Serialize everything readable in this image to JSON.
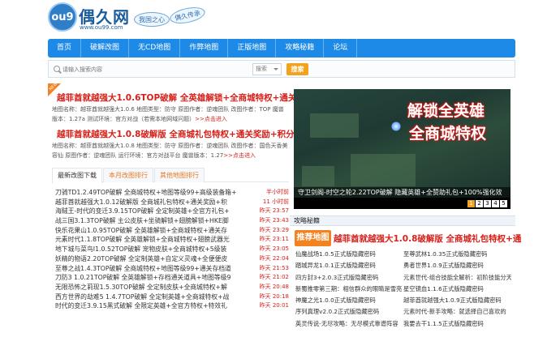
{
  "brand": {
    "logo_mark": "ou9",
    "name": "偶久网",
    "url": "www.ou99.com",
    "slogan_1": "我国之心",
    "slogan_2": "偶久传承"
  },
  "nav": {
    "items": [
      "首页",
      "破解改图",
      "无CD地图",
      "作弊地图",
      "正版地图",
      "攻略秘籍",
      "论坛"
    ]
  },
  "search": {
    "placeholder": "请输入搜索内容",
    "category": "搜索",
    "button": "搜索"
  },
  "headlines": {
    "badge": "NEW",
    "items": [
      {
        "title": "越菲酋就越强大1.0.6TOP破解 全英雄解锁+全商城特权+通关存档",
        "desc": "地图名称：越菲酋就越强大1.0.6 地图类型：防守 原图作者：逆魂团队 改图作者：TOP 魔兽版本：1.27a 测试环境：官方对战（若需本地网域问题）",
        "more": ">>点击进入"
      },
      {
        "title": "越菲酋就越强大1.0.8破解版 全商城礼包特权+通关奖励+积分道具",
        "desc": "地图名称：越菲酋就越强大1.0.8 地图类型：防守 原图作者：逆魂团队 改图作者：国色天香美容仙 原图作者：逆魂团队 运行环境：官方对战平台 魔兽版本：1.27",
        "more": ">>点击进入"
      }
    ]
  },
  "tabs": [
    "最新改图下载",
    "本月改图排行",
    "其他地图排行"
  ],
  "downloads": [
    {
      "title": "刀骑TD1.2.49TOP破解 全商城特权+地图等级99+高级装备箱+",
      "date": "半小时前"
    },
    {
      "title": "越菲酋就越强大1.0.12破解版 全商城礼包特权+通关奖励+积",
      "date": "11 小时前"
    },
    {
      "title": "海贼王-时代的变迁3.9.15TOP破解 全定制英雄+全官方礼包+",
      "date": "昨天 23:57"
    },
    {
      "title": "战三国3.1.3TOP破解 主公皮肤+坐骑解锁+翅膀解锁+HKE脚",
      "date": "昨天 23:43"
    },
    {
      "title": "快乐花果山1.0.95TOP破解 全英雄解锁+全商城特权+通关存",
      "date": "昨天 23:29"
    },
    {
      "title": "元素时代1.1.8TOP破解 全英雄解锁+全商城特权+翅膀武器光",
      "date": "昨天 23:11"
    },
    {
      "title": "地下城与菜鸟Ⅰ1.0.52TOP破解 宠物皮肤+全商城特权+5级装",
      "date": "昨天 23:05"
    },
    {
      "title": "妖精的物语2.20TOP破解 全定制英雄+自定义灵魂+全便便皮",
      "date": "昨天 22:04"
    },
    {
      "title": "至尊之战1.4.3TOP破解 全商城特权+地图等级99+通关存档道",
      "date": "昨天 21:53"
    },
    {
      "title": "刀防3 1.0.21TOP破解 全英雄解锁+存档通关道具+地图等级9",
      "date": "昨天 21:02"
    },
    {
      "title": "无限恐怖之莉现1.5.30TOP破解 全定制皮肤+全商城特权+解",
      "date": "昨天 20:48"
    },
    {
      "title": "西方世界的劫难5 1.4.7TOP破解 全定制英雄+全商城特权+战",
      "date": "昨天 20:18"
    },
    {
      "title": "时代的变迁3.9.15黑式破解 全限定英雄+全官方特权+特效礼",
      "date": "昨天 20:01"
    }
  ],
  "banner": {
    "line1": "解锁全英雄",
    "line2": "全商城特权",
    "caption": "守卫剑阁-时空之轮2.22TOP破解 隐藏英雄+全赞助礼包+100%强化效",
    "pages": [
      "1",
      "2",
      "3",
      "4",
      "5"
    ],
    "active_page": 0
  },
  "strategy": {
    "header": "攻略秘籍",
    "badge": "推荐地图",
    "headline": "越菲酋就越强大1.0.8破解版 全商城礼包特权+通",
    "rows": [
      [
        "仙魔战场1.0.5正式版隐藏密码",
        "至尊武林1.0.35正式版隐藏密码"
      ],
      [
        "踏城异龙1.0.1正式版隐藏密码",
        "勇者世界1.0.9正式版隐藏密码"
      ],
      [
        "四方封3+2.0.3正式版隐藏密码",
        "元素世代-组合技能全解析：初阶技能分天"
      ],
      [
        "新蜀推零第三期：相信群众的眼睛是雪亮",
        "星空镜血1.1.6正式版隐藏密码"
      ],
      [
        "神魔之光1.0.0正式版隐藏密码",
        "越菲酋就越强大1.0.9正式版隐藏密码"
      ],
      [
        "序列真理v2.0.2正式版隐藏密码",
        "元素时代-新手攻略：就选择自己喜欢的"
      ],
      [
        "英灵传说-无尽攻略：无尽模式靠谱阵容",
        "我要去干1.1.5正式版隐藏密码"
      ]
    ]
  },
  "colors": {
    "nav_blue": "#1d8ae8",
    "title_red": "#d8201a",
    "accent_orange": "#f58220"
  }
}
